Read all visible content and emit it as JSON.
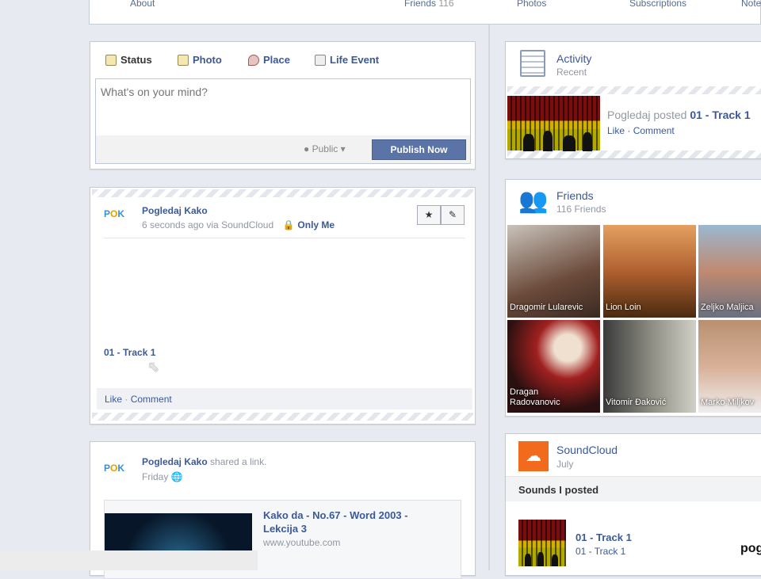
{
  "nav": {
    "about": "About",
    "friends": "Friends",
    "friends_count": "116",
    "photos": "Photos",
    "subscriptions": "Subscriptions",
    "notes": "Note"
  },
  "composer": {
    "tabs": [
      "Status",
      "Photo",
      "Place",
      "Life Event"
    ],
    "placeholder": "What's on your mind?",
    "privacy": "Public",
    "publish": "Publish Now"
  },
  "post1": {
    "author": "Pogledaj Kako",
    "meta": "6 seconds ago via SoundCloud",
    "privacy": "Only Me",
    "track": "01 - Track 1",
    "like": "Like",
    "comment": "Comment",
    "sep": "·"
  },
  "post2": {
    "author": "Pogledaj Kako",
    "action": "shared a link.",
    "time": "Friday",
    "link_title": "Kako da - No.67 - Word 2003 - Lekcija 3",
    "link_domain": "www.youtube.com"
  },
  "activity": {
    "title": "Activity",
    "subtitle": "Recent",
    "author": "Pogledaj",
    "verb": "posted",
    "object": "01 - Track 1",
    "like": "Like",
    "comment": "Comment"
  },
  "friends": {
    "title": "Friends",
    "subtitle": "116 Friends",
    "people": [
      "Dragomir Lularevic",
      "Lion Loin",
      "Zeljko Maljica",
      "Dragan Radovanovic",
      "Vitomir Đaković",
      "Marko Miljkov"
    ]
  },
  "soundcloud": {
    "title": "SoundCloud",
    "subtitle": "July",
    "section": "Sounds I posted",
    "track_title": "01 - Track 1",
    "track_sub": "01 - Track 1",
    "brand_partial": "pog"
  },
  "colors": {
    "link": "#3b5998",
    "publish": "#5b74a8",
    "soundcloud": "#f26a1b"
  }
}
